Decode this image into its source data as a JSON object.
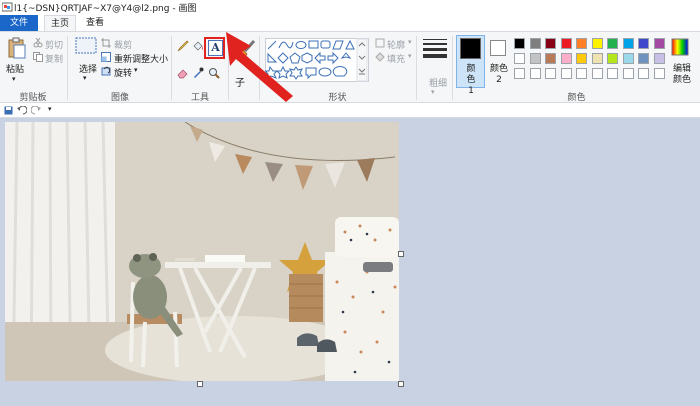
{
  "window": {
    "title": "l1{~DSN}QRTJAF~X7@Y4@l2.png - 画图"
  },
  "tabs": {
    "file": "文件",
    "home": "主页",
    "view": "查看"
  },
  "clipboard": {
    "paste": "粘贴",
    "cut": "剪切",
    "copy": "复制",
    "label": "剪贴板"
  },
  "image": {
    "select": "选择",
    "crop": "裁剪",
    "resize": "重新调整大小",
    "rotate": "旋转",
    "label": "图像"
  },
  "tools": {
    "label": "工具",
    "text_glyph": "A"
  },
  "brushes": {
    "label": "子"
  },
  "shapes": {
    "outline": "轮廓",
    "fill": "填充",
    "label": "形状"
  },
  "size": {
    "label": "粗细"
  },
  "colors": {
    "color1": "颜色 1",
    "color2": "颜色 2",
    "edit": "编辑颜色",
    "label": "颜色",
    "color1_value": "#000000",
    "color2_value": "#ffffff",
    "palette_row1": [
      "#000000",
      "#7f7f7f",
      "#880015",
      "#ed1c24",
      "#ff7f27",
      "#fff200",
      "#22b14c",
      "#00a2e8",
      "#3f48cc",
      "#a349a4"
    ],
    "palette_row2": [
      "#ffffff",
      "#c3c3c3",
      "#b97a57",
      "#ffaec9",
      "#ffc90e",
      "#efe4b0",
      "#b5e61d",
      "#99d9ea",
      "#7092be",
      "#c8bfe7"
    ],
    "palette_row3": [
      "#ffffff",
      "#ffffff",
      "#ffffff",
      "#ffffff",
      "#ffffff",
      "#ffffff",
      "#ffffff",
      "#ffffff",
      "#ffffff",
      "#ffffff"
    ]
  },
  "annotation": {
    "highlight_color": "#e0231f"
  }
}
